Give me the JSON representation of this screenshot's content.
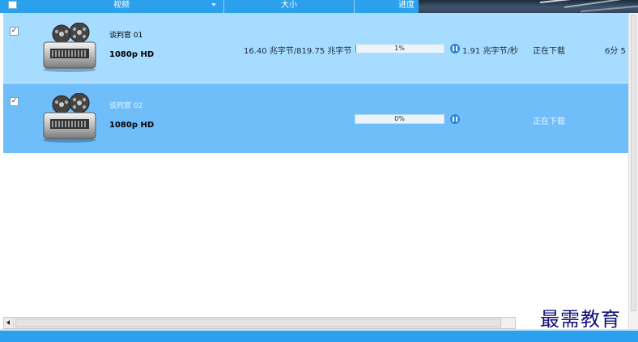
{
  "header": {
    "col_video": "视频",
    "col_size": "大小",
    "col_progress": "进度"
  },
  "rows": [
    {
      "checked": "✓",
      "title": "谈判官 01",
      "quality": "1080p HD",
      "size": "16.40 兆字节/819.75 兆字节",
      "progress_text": "1%",
      "progress_fraction": 0.01,
      "speed": "1.91 兆字节/秒",
      "status": "正在下载",
      "remaining": "6分 5"
    },
    {
      "checked": "✓",
      "title": "谈判官 02",
      "quality": "1080p HD",
      "size": "",
      "progress_text": "0%",
      "progress_fraction": 0.0,
      "speed": "",
      "status": "正在下载",
      "remaining": ""
    }
  ],
  "watermark": "最需教育",
  "colors": {
    "header": "#2ba0ec",
    "row_normal": "#a6dcff",
    "row_selected": "#6fbefa",
    "pause": "#2b88d8"
  },
  "icons": {
    "video_icon": "film-reel-projector-icon",
    "pause_icon": "pause-circle-icon",
    "sort_icon": "sort-down-icon"
  }
}
